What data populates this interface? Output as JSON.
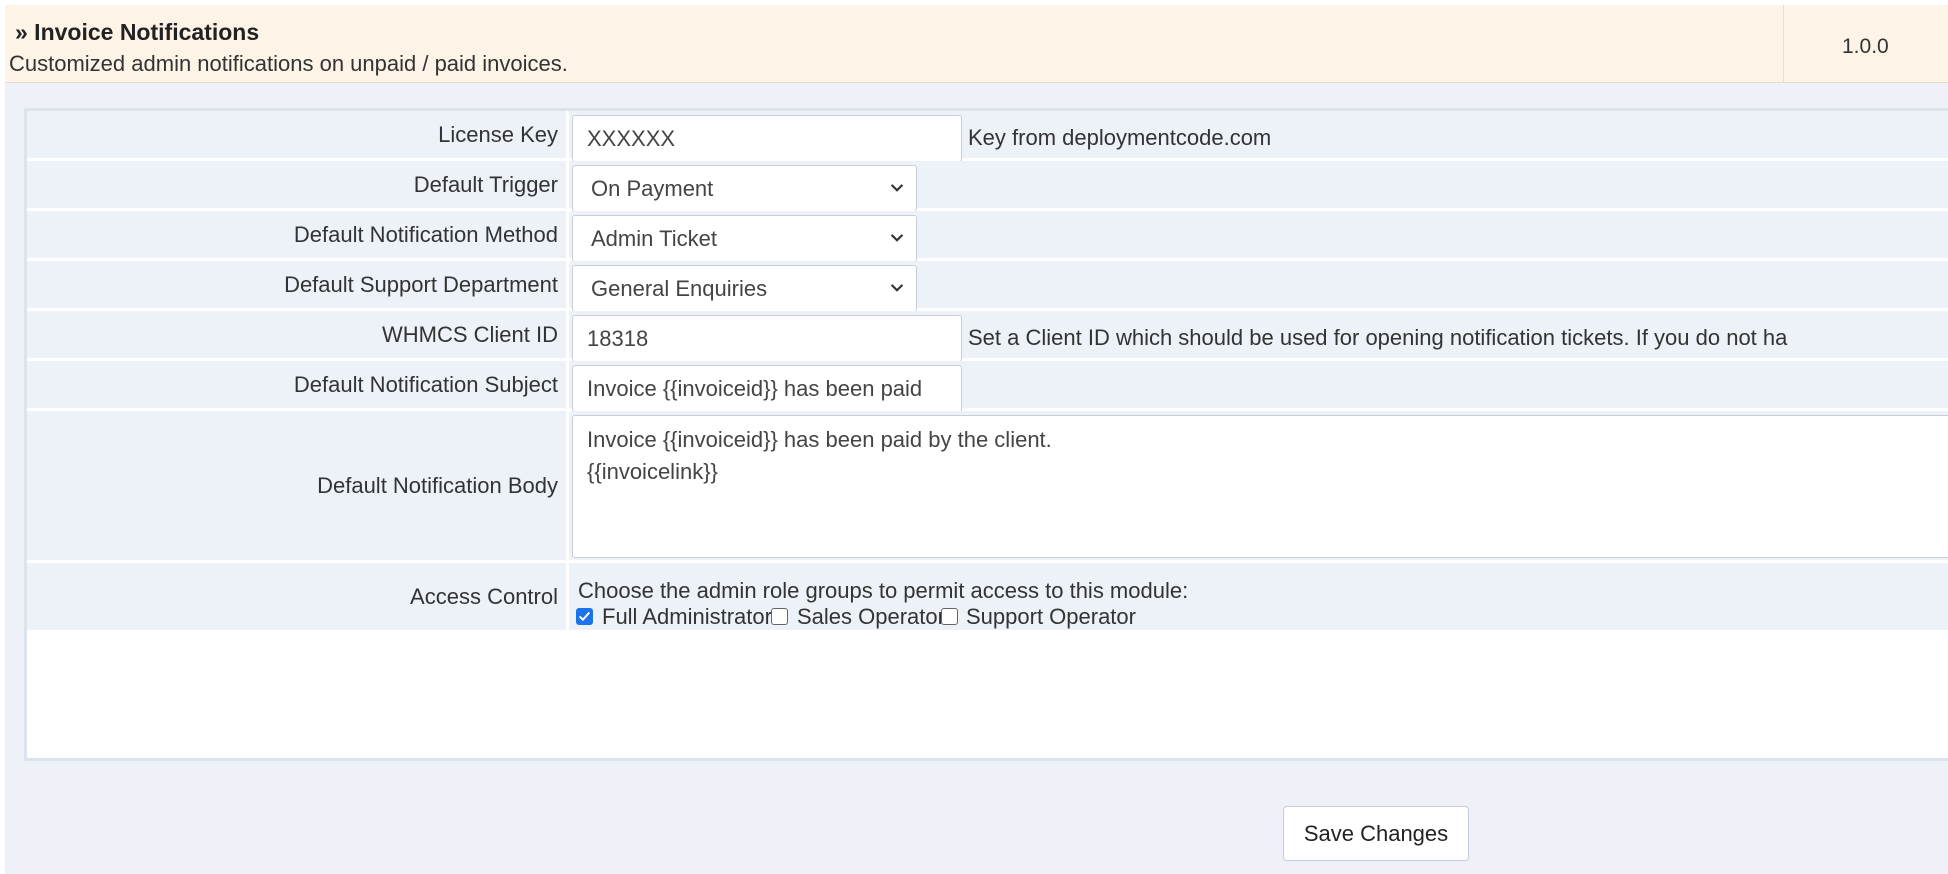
{
  "module": {
    "name": "» Invoice Notifications",
    "description": "Customized admin notifications on unpaid / paid invoices.",
    "version": "1.0.0"
  },
  "fields": {
    "license_key": {
      "label": "License Key",
      "value": "XXXXXX",
      "hint": "Key from deploymentcode.com"
    },
    "default_trigger": {
      "label": "Default Trigger",
      "value": "On Payment"
    },
    "notification_method": {
      "label": "Default Notification Method",
      "value": "Admin Ticket"
    },
    "support_department": {
      "label": "Default Support Department",
      "value": "General Enquiries"
    },
    "client_id": {
      "label": "WHMCS Client ID",
      "value": "18318",
      "hint": "Set a Client ID which should be used for opening notification tickets. If you do not ha"
    },
    "notification_subject": {
      "label": "Default Notification Subject",
      "value": "Invoice {{invoiceid}} has been paid"
    },
    "notification_body": {
      "label": "Default Notification Body",
      "value": "Invoice {{invoiceid}} has been paid by the client.\n{{invoicelink}}"
    },
    "access_control": {
      "label": "Access Control",
      "description": "Choose the admin role groups to permit access to this module:",
      "options": [
        {
          "label": "Full Administrator",
          "checked": true
        },
        {
          "label": "Sales Operator",
          "checked": false
        },
        {
          "label": "Support Operator",
          "checked": false
        }
      ]
    }
  },
  "save_button": "Save Changes",
  "icons": {
    "select_arrow": "chevron-down-icon",
    "checkbox_check": "checkmark-icon"
  },
  "colors": {
    "header_bg": "#fdf3e6",
    "panel_bg": "#edf1f8",
    "checkbox_accent": "#1a73e8"
  }
}
